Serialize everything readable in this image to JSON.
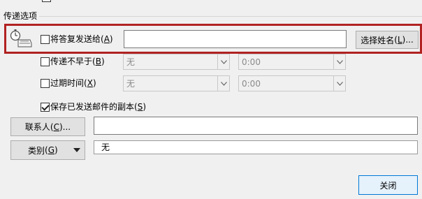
{
  "section": {
    "title": "传递选项"
  },
  "reply": {
    "label": "将答复发送给",
    "accel": "A",
    "value": "",
    "button": {
      "label": "选择姓名",
      "accel": "L",
      "suffix": "..."
    },
    "highlight_color": "#b22222"
  },
  "do_not_deliver": {
    "label": "传递不早于",
    "accel": "B",
    "date": "无",
    "time": "0:00"
  },
  "expires": {
    "label": "过期时间",
    "accel": "X",
    "date": "无",
    "time": "0:00"
  },
  "save_copy": {
    "label": "保存已发送邮件的副本",
    "accel": "S",
    "checked": true
  },
  "contacts": {
    "label": "联系人",
    "accel": "C",
    "suffix": "...",
    "value": ""
  },
  "categories": {
    "label": "类别",
    "accel": "G",
    "value": "无"
  },
  "close": {
    "label": "关闭"
  }
}
